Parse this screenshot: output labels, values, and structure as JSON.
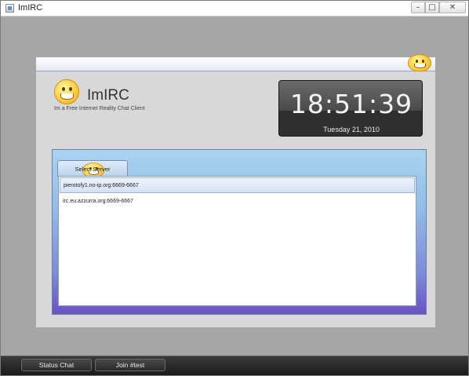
{
  "window": {
    "title": "ImIRC",
    "min_symbol": "–",
    "max_symbol": "□",
    "close_symbol": "✕"
  },
  "app": {
    "name": "ImIRC",
    "tagline": "Im a Free Internet Reality Chat Client"
  },
  "clock": {
    "time": "18:51:39",
    "date": "Tuesday 21, 2010"
  },
  "servers": {
    "tab_label": "Select Server",
    "items": [
      "pierotofy1.no-ip.org:6669-6667",
      "irc.eu.azzurra.org:6669-6667"
    ],
    "selected_index": 0
  },
  "bottom_bar": {
    "status_chat": "Status Chat",
    "join": "Join #test"
  }
}
